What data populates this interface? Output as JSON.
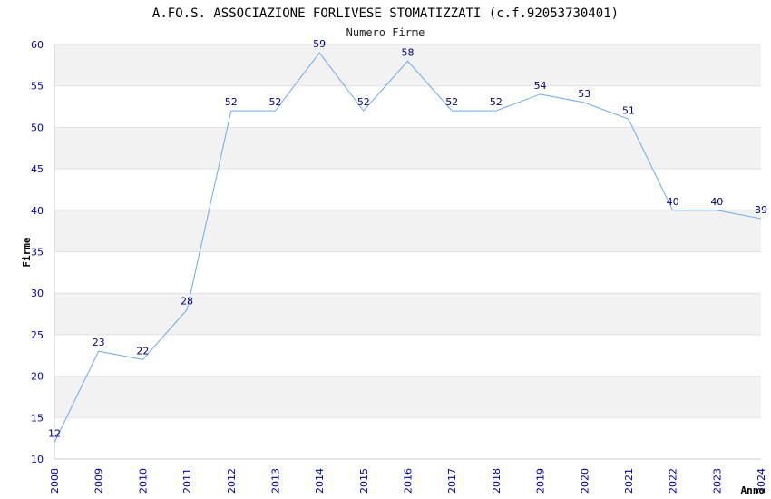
{
  "chart_data": {
    "type": "line",
    "title": "A.FO.S. ASSOCIAZIONE FORLIVESE STOMATIZZATI (c.f.92053730401)",
    "subtitle": "Numero Firme",
    "xlabel": "Anno",
    "ylabel": "Firme",
    "ylim": [
      10,
      60
    ],
    "yticks": [
      10,
      15,
      20,
      25,
      30,
      35,
      40,
      45,
      50,
      55,
      60
    ],
    "x": [
      "2008",
      "2009",
      "2010",
      "2011",
      "2012",
      "2013",
      "2014",
      "2015",
      "2016",
      "2017",
      "2018",
      "2019",
      "2020",
      "2021",
      "2022",
      "2023",
      "2024"
    ],
    "values": [
      12,
      23,
      22,
      28,
      52,
      52,
      59,
      52,
      58,
      52,
      52,
      54,
      53,
      51,
      40,
      40,
      39
    ],
    "grid": "horizontal",
    "colors": {
      "line": "#66aaee",
      "band": "#f2f2f2",
      "tick": "#0000aa",
      "label": "#000080"
    }
  }
}
